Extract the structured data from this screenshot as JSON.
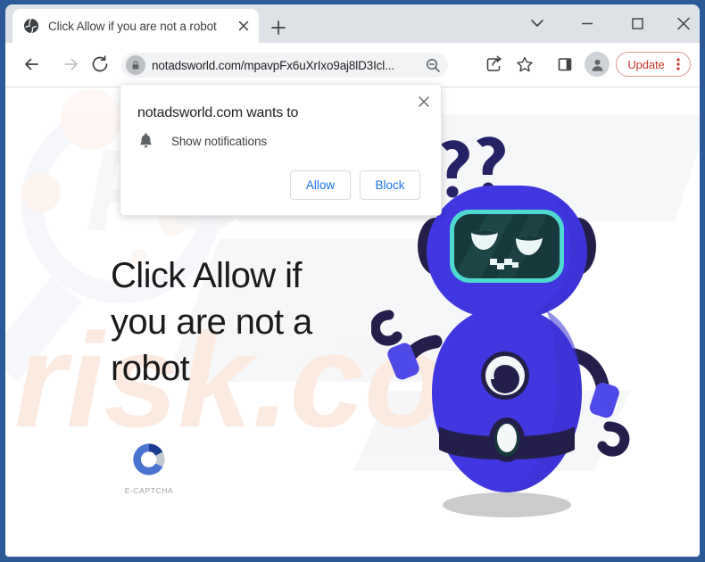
{
  "window": {
    "controls": [
      {
        "name": "tab-search-button",
        "icon": "chevron-down-icon",
        "label": ""
      },
      {
        "name": "minimize-button",
        "icon": "minimize-icon",
        "label": ""
      },
      {
        "name": "maximize-button",
        "icon": "maximize-icon",
        "label": ""
      },
      {
        "name": "close-window-button",
        "icon": "close-icon",
        "label": ""
      }
    ]
  },
  "tab": {
    "title": "Click Allow if you are not a robot",
    "favicon": "globe-icon",
    "close_icon": "close-icon",
    "new_tab_icon": "plus-icon"
  },
  "toolbar": {
    "back_icon": "back-arrow-icon",
    "forward_icon": "forward-arrow-icon",
    "reload_icon": "reload-icon",
    "lock_icon": "lock-icon",
    "url": "notadsworld.com/mpavpFx6uXrIxo9aj8lD3Icl...",
    "zoom_icon": "zoom-out-icon",
    "share_icon": "share-icon",
    "bookmark_icon": "star-icon",
    "side_panel_icon": "side-panel-icon",
    "profile_icon": "profile-avatar-icon",
    "update_label": "Update",
    "update_menu_icon": "three-dots-icon",
    "update_color": "#c5342c"
  },
  "notification_bubble": {
    "title": "notadsworld.com wants to",
    "permission_icon": "bell-icon",
    "permission_label": "Show notifications",
    "allow_label": "Allow",
    "block_label": "Block",
    "close_icon": "close-icon",
    "button_text_color": "#1a73e8"
  },
  "page": {
    "heading": "Click Allow if you are not a robot",
    "captcha": {
      "logo_icon": "c-captcha-logo-icon",
      "label": "E-CAPTCHA",
      "primary_color": "#4a72d0",
      "secondary_color": "#1b3a8f"
    },
    "mascot": {
      "name": "confused-robot-illustration",
      "thought_marks": "??",
      "body_color": "#4037e0",
      "visor_color": "#17393b",
      "visor_border_color": "#4ed9d0",
      "dark_color": "#231f4a"
    },
    "watermark_text": "risk.com",
    "watermark_color": "#fbeee7"
  }
}
